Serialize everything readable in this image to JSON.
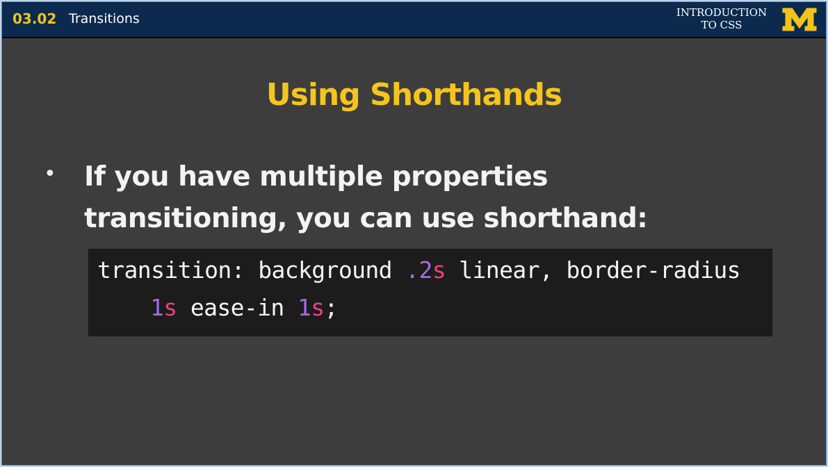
{
  "header": {
    "course_code": "03.02",
    "lesson_title": "Transitions",
    "course_name_line1": "INTRODUCTION",
    "course_name_line2": "TO CSS",
    "logo": "block-M-logo",
    "colors": {
      "bar": "#0c2a4e",
      "accent": "#f2c418"
    }
  },
  "slide": {
    "title": "Using Shorthands",
    "bullet": {
      "line1": "If you have multiple properties",
      "line2": "transitioning, you can use shorthand:"
    },
    "code": {
      "line1": {
        "t1": "transition: background ",
        "n1": ".2",
        "u1": "s",
        "t2": " linear, border-radius"
      },
      "line2": {
        "n1": "1",
        "u1": "s",
        "t1": " ease-in ",
        "n2": "1",
        "u2": "s",
        "t2": ";"
      }
    },
    "colors": {
      "background": "#3d3d3d",
      "title": "#f4c51d",
      "code_background": "#1c1c1c",
      "code_number": "#a56ce2",
      "code_unit": "#ed3f86"
    }
  }
}
